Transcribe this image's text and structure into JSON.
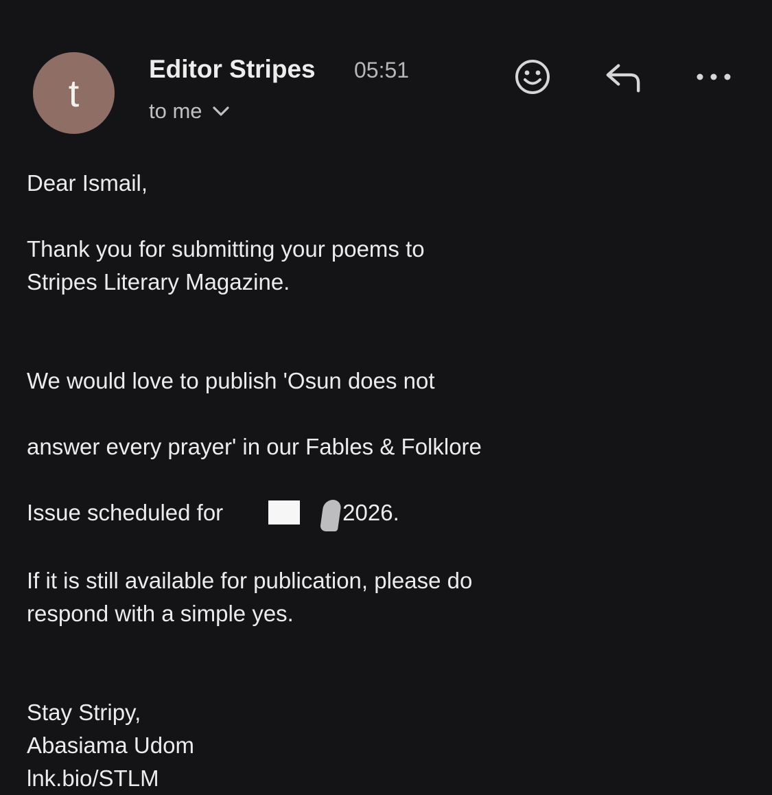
{
  "header": {
    "avatar_initial": "t",
    "avatar_color": "#8f6e66",
    "sender_name": "Editor Stripes",
    "time": "05:51",
    "recipient": "to me",
    "recipient_toggle_icon": "chevron-down-icon",
    "actions": [
      {
        "name": "add-reaction",
        "icon": "smiley-icon"
      },
      {
        "name": "reply",
        "icon": "reply-arrow-icon"
      },
      {
        "name": "more-options",
        "icon": "more-horizontal-icon"
      }
    ]
  },
  "message": {
    "greeting": "Dear Ismail,",
    "p1": "Thank you for submitting your poems to\nStripes Literary Magazine.",
    "p2_line1": "We would love to publish 'Osun does not",
    "p2_line2": "answer every prayer' in our Fables & Folklore",
    "p2_line3_start": "Issue scheduled for",
    "p2_line3_end": "2026.",
    "p3": "If it is still available for publication, please do\nrespond with a simple yes.",
    "signoff": "Stay Stripy,",
    "signature_name": "Abasiama Udom",
    "signature_link": "lnk.bio/STLM"
  },
  "colors": {
    "background": "#141416",
    "text": "#ececee",
    "muted": "#b7b7ba"
  }
}
